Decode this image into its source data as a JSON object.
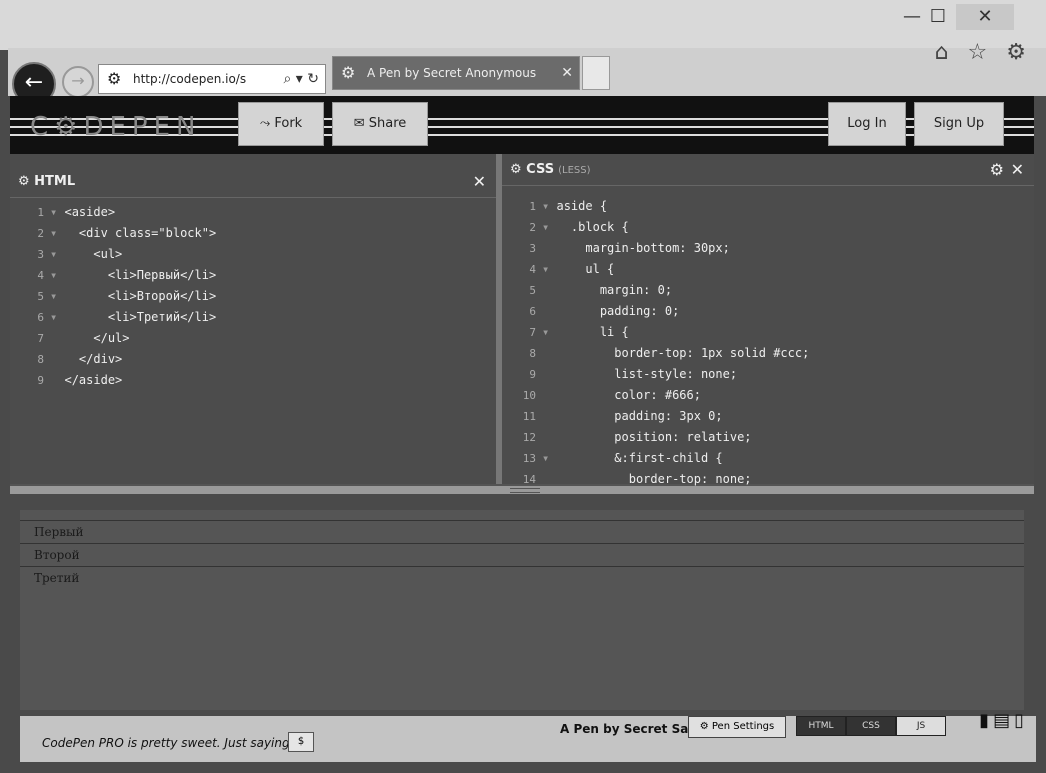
{
  "window": {
    "minimize": "—",
    "maximize": "☐",
    "close": "✕"
  },
  "browser": {
    "back_glyph": "←",
    "forward_glyph": "→",
    "address": "http://codepen.io/s",
    "address_tools": "⌕ ▾ ↻",
    "tab_title": "A Pen by Secret Anonymous",
    "tab_close": "✕",
    "icons": [
      "home-icon",
      "star-icon",
      "gear-icon"
    ],
    "icon_glyphs": "⌂ ☆ ⚙"
  },
  "codepen": {
    "logo": "C⚙DEPEN",
    "fork_label": "⤳ Fork",
    "share_label": "✉ Share",
    "login_label": "Log In",
    "signup_label": "Sign Up"
  },
  "html_pane": {
    "title": "⚙ HTML",
    "close": "✕",
    "lines": [
      {
        "n": "1",
        "fold": "▾",
        "code": "<aside>"
      },
      {
        "n": "2",
        "fold": "▾",
        "code": "  <div class=\"block\">"
      },
      {
        "n": "3",
        "fold": "▾",
        "code": "    <ul>"
      },
      {
        "n": "4",
        "fold": "▾",
        "code": "      <li>Первый</li>"
      },
      {
        "n": "5",
        "fold": "▾",
        "code": "      <li>Второй</li>"
      },
      {
        "n": "6",
        "fold": "▾",
        "code": "      <li>Третий</li>"
      },
      {
        "n": "7",
        "fold": " ",
        "code": "    </ul>"
      },
      {
        "n": "8",
        "fold": " ",
        "code": "  </div>"
      },
      {
        "n": "9",
        "fold": " ",
        "code": "</aside>"
      }
    ]
  },
  "css_pane": {
    "title": "⚙ CSS",
    "subtitle": "(LESS)",
    "close": "✕",
    "settings_glyph": "⚙",
    "lines": [
      {
        "n": "1",
        "fold": "▾",
        "code": "aside {"
      },
      {
        "n": "2",
        "fold": "▾",
        "code": "  .block {"
      },
      {
        "n": "3",
        "fold": " ",
        "code": "    margin-bottom: 30px;"
      },
      {
        "n": "4",
        "fold": "▾",
        "code": "    ul {"
      },
      {
        "n": "5",
        "fold": " ",
        "code": "      margin: 0;"
      },
      {
        "n": "6",
        "fold": " ",
        "code": "      padding: 0;"
      },
      {
        "n": "7",
        "fold": "▾",
        "code": "      li {"
      },
      {
        "n": "8",
        "fold": " ",
        "code": "        border-top: 1px solid #ccc;"
      },
      {
        "n": "9",
        "fold": " ",
        "code": "        list-style: none;"
      },
      {
        "n": "10",
        "fold": " ",
        "code": "        color: #666;"
      },
      {
        "n": "11",
        "fold": " ",
        "code": "        padding: 3px 0;"
      },
      {
        "n": "12",
        "fold": " ",
        "code": "        position: relative;"
      },
      {
        "n": "13",
        "fold": "▾",
        "code": "        &:first-child {"
      },
      {
        "n": "14",
        "fold": " ",
        "code": "          border-top: none;"
      }
    ]
  },
  "result": {
    "items": [
      "Первый",
      "Второй",
      "Третий"
    ]
  },
  "footer": {
    "promo": "CodePen PRO is pretty sweet. Just saying.",
    "promo_button": "$",
    "author": "A Pen by Secret Sam",
    "settings": "⚙ Pen Settings",
    "seg_html": "HTML",
    "seg_css": "CSS",
    "seg_js": "JS",
    "layout_glyphs": "▮▤▯"
  }
}
